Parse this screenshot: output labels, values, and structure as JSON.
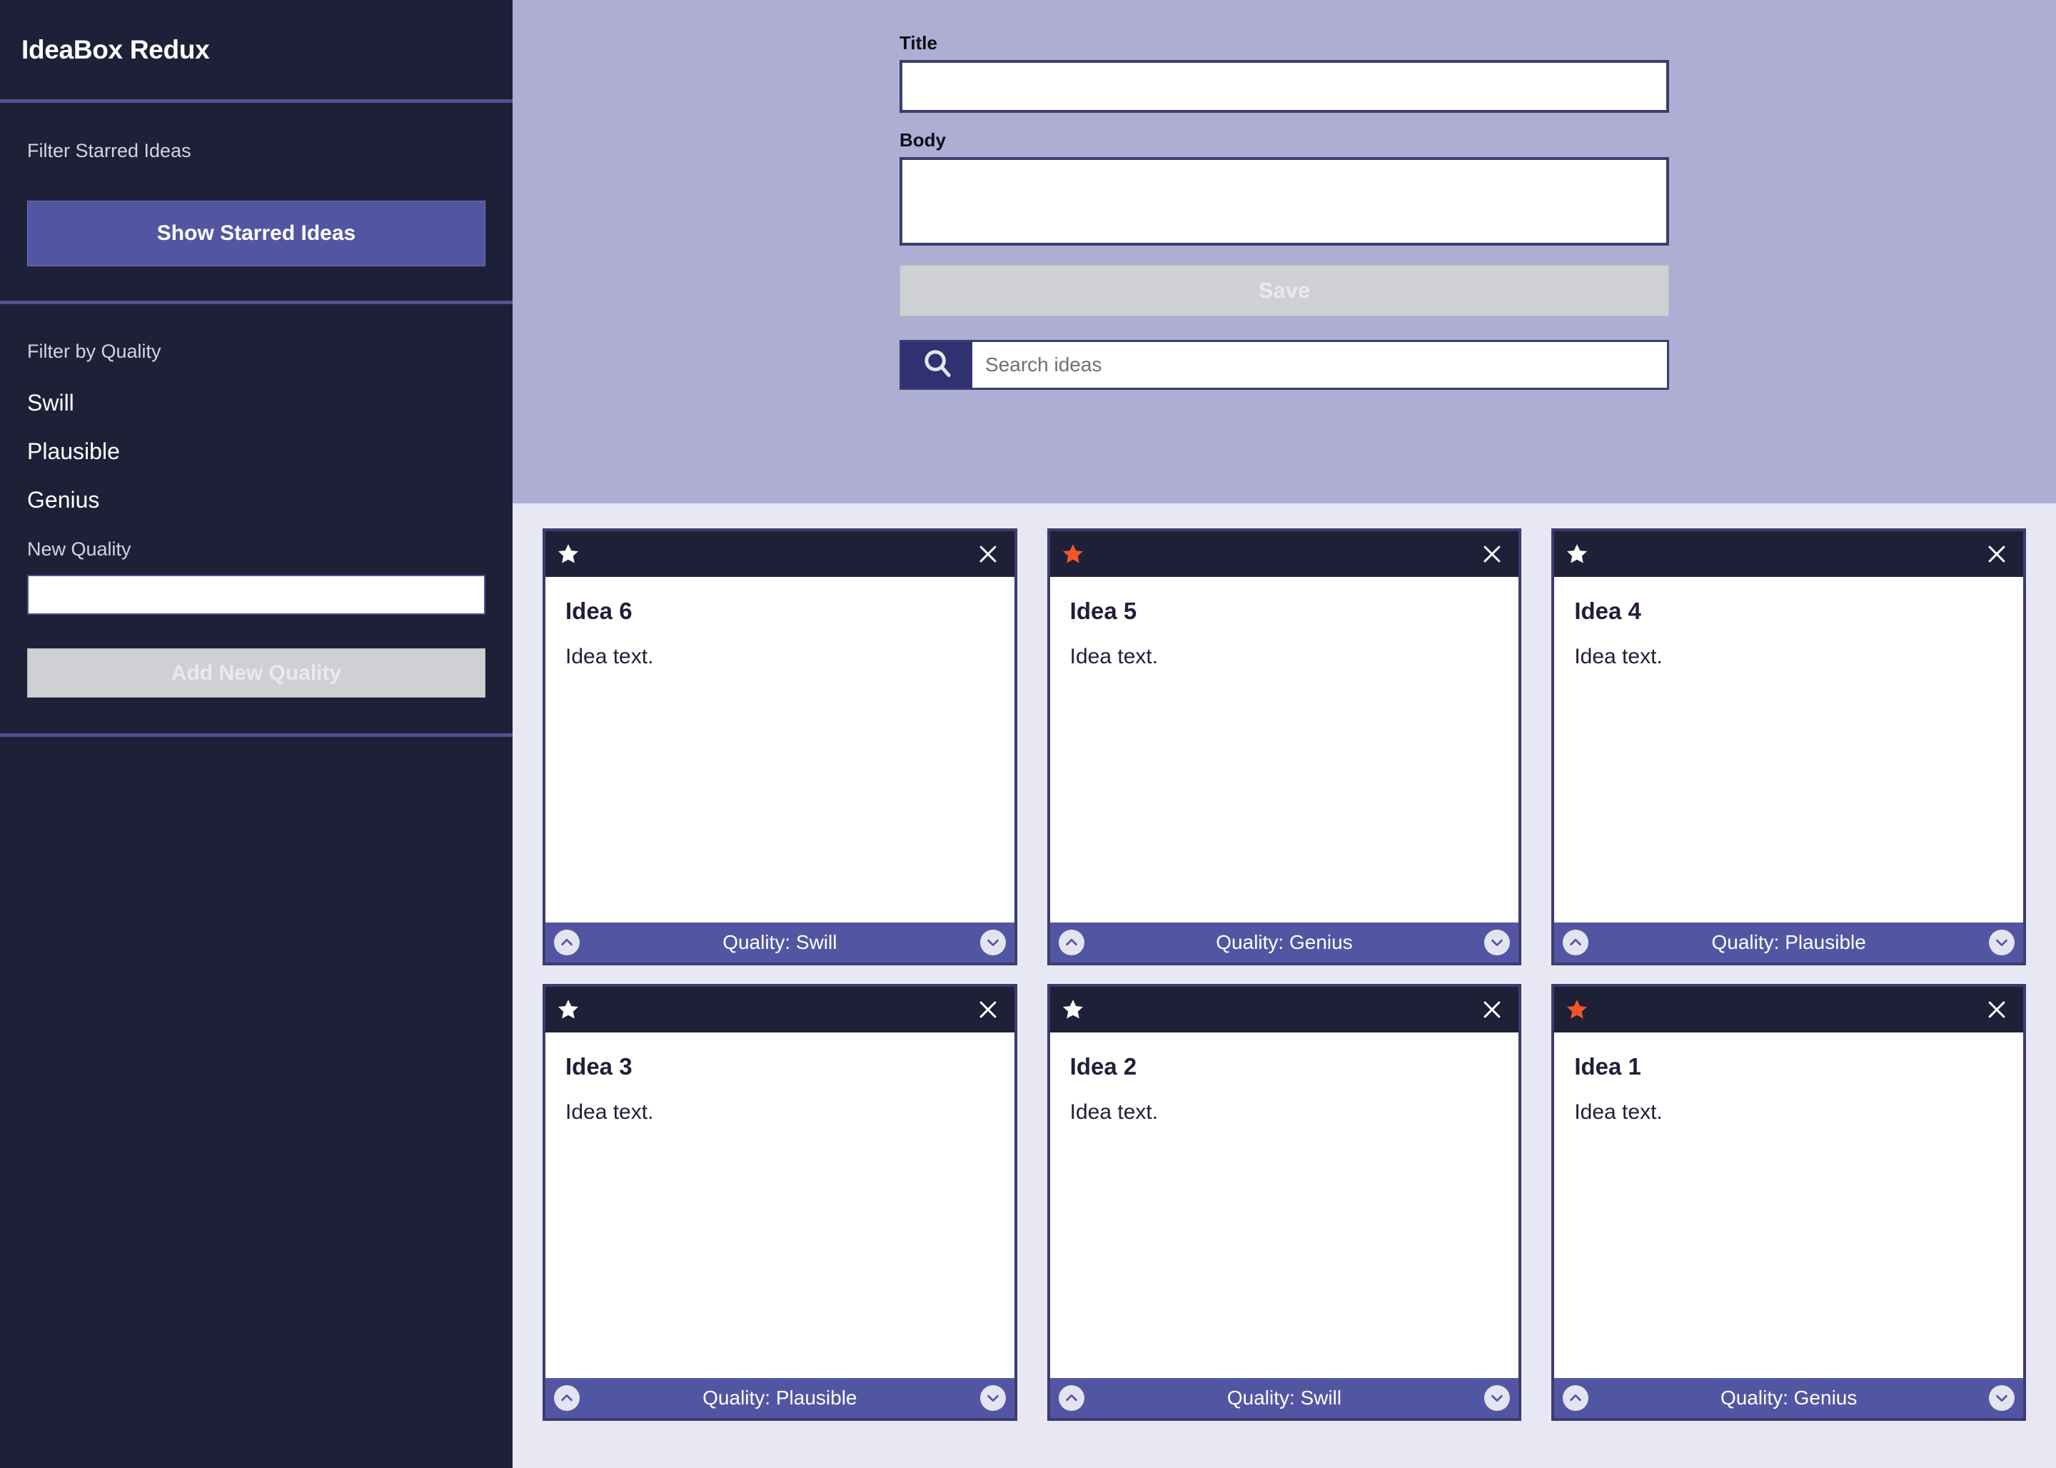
{
  "app": {
    "title": "IdeaBox Redux"
  },
  "sidebar": {
    "starred_section": {
      "label": "Filter Starred Ideas",
      "button_label": "Show Starred Ideas"
    },
    "quality_section": {
      "label": "Filter by Quality",
      "qualities": [
        "Swill",
        "Plausible",
        "Genius"
      ],
      "new_quality_label": "New Quality",
      "new_quality_value": "",
      "new_quality_placeholder": "",
      "add_button_label": "Add New Quality"
    }
  },
  "form": {
    "title_label": "Title",
    "title_value": "",
    "title_placeholder": "",
    "body_label": "Body",
    "body_value": "",
    "body_placeholder": "",
    "save_label": "Save",
    "search_placeholder": "Search ideas",
    "search_value": "",
    "search_icon": "search-icon"
  },
  "colors": {
    "sidebar_bg": "#1e2038",
    "accent_purple": "#5256a2",
    "form_panel_bg": "#aeaed4",
    "cards_bg": "#e7e8f3",
    "card_border": "#3b3d70",
    "card_header_bg": "#1e2038",
    "star_active": "#f0562a",
    "star_inactive": "#ffffff",
    "disabled_button_bg": "#cfd0d4",
    "divider": "#4f528f"
  },
  "cards": [
    {
      "title": "Idea 6",
      "text": "Idea text.",
      "quality_label": "Quality: Swill",
      "quality": "Swill",
      "starred": false
    },
    {
      "title": "Idea 5",
      "text": "Idea text.",
      "quality_label": "Quality: Genius",
      "quality": "Genius",
      "starred": true
    },
    {
      "title": "Idea 4",
      "text": "Idea text.",
      "quality_label": "Quality: Plausible",
      "quality": "Plausible",
      "starred": false
    },
    {
      "title": "Idea 3",
      "text": "Idea text.",
      "quality_label": "Quality: Plausible",
      "quality": "Plausible",
      "starred": false
    },
    {
      "title": "Idea 2",
      "text": "Idea text.",
      "quality_label": "Quality: Swill",
      "quality": "Swill",
      "starred": false
    },
    {
      "title": "Idea 1",
      "text": "Idea text.",
      "quality_label": "Quality: Genius",
      "quality": "Genius",
      "starred": true
    }
  ]
}
